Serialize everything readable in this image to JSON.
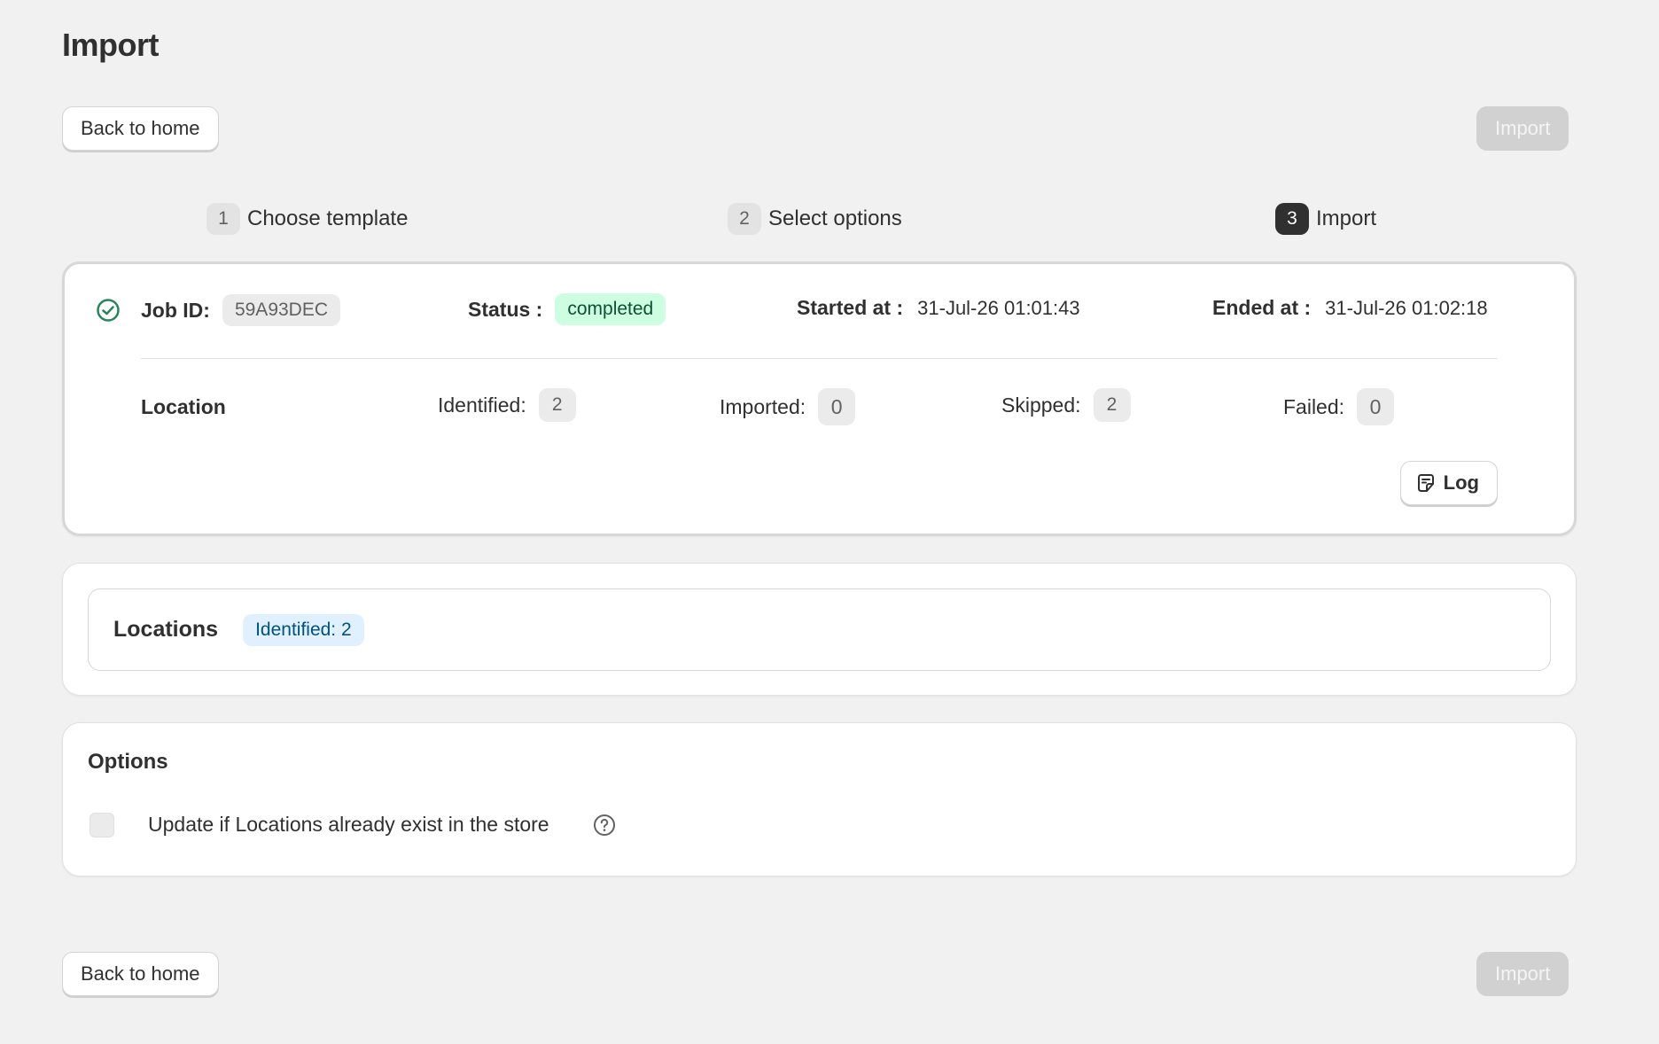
{
  "page": {
    "title": "Import"
  },
  "header": {
    "back_label": "Back to home",
    "import_label": "Import"
  },
  "steps": [
    {
      "num": "1",
      "label": "Choose template"
    },
    {
      "num": "2",
      "label": "Select options"
    },
    {
      "num": "3",
      "label": "Import"
    }
  ],
  "job": {
    "id_label": "Job ID:",
    "id": "59A93DEC",
    "status_label": "Status :",
    "status": "completed",
    "started_label": "Started at :",
    "started": "31-Jul-26 01:01:43",
    "ended_label": "Ended at :",
    "ended": "31-Jul-26 01:02:18",
    "entity": "Location",
    "stats": {
      "identified_label": "Identified:",
      "identified": "2",
      "imported_label": "Imported:",
      "imported": "0",
      "skipped_label": "Skipped:",
      "skipped": "2",
      "failed_label": "Failed:",
      "failed": "0"
    },
    "log_label": "Log"
  },
  "locations": {
    "title": "Locations",
    "badge": "Identified: 2"
  },
  "options": {
    "title": "Options",
    "update_label": "Update if Locations already exist in the store",
    "update_checked": false
  },
  "footer": {
    "back_label": "Back to home",
    "import_label": "Import"
  },
  "colors": {
    "background": "#f1f1f1",
    "success_badge": "#cdfee1",
    "info_badge": "#e0f0ff",
    "active_step": "#303030",
    "success_icon": "#29845a"
  },
  "icons": [
    "check-circle-icon",
    "note-icon",
    "question-circle-icon"
  ]
}
